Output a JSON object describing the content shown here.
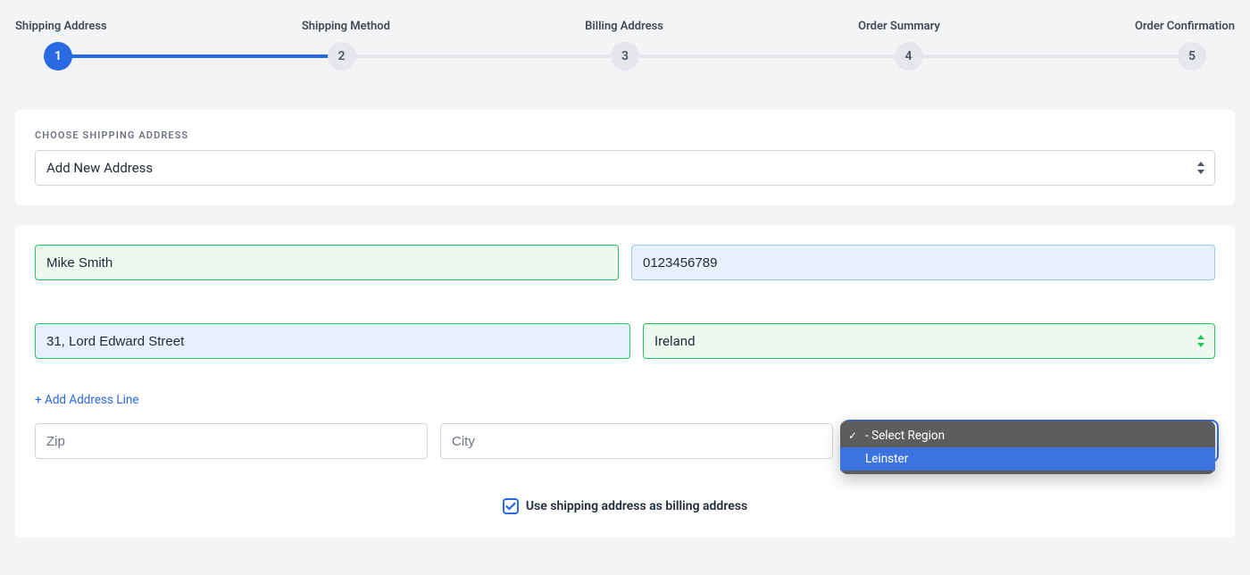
{
  "stepper": {
    "steps": [
      {
        "label": "Shipping Address",
        "num": "1",
        "active": true
      },
      {
        "label": "Shipping Method",
        "num": "2",
        "active": false
      },
      {
        "label": "Billing Address",
        "num": "3",
        "active": false
      },
      {
        "label": "Order Summary",
        "num": "4",
        "active": false
      },
      {
        "label": "Order Confirmation",
        "num": "5",
        "active": false
      }
    ]
  },
  "choose": {
    "label": "CHOOSE SHIPPING ADDRESS",
    "value": "Add New Address"
  },
  "form": {
    "name": "Mike Smith",
    "phone": "0123456789",
    "street": "31, Lord Edward Street",
    "country": "Ireland",
    "add_line": "+ Add Address Line",
    "zip_placeholder": "Zip",
    "city_placeholder": "City",
    "region_options": {
      "placeholder": "- Select Region",
      "opt1": "Leinster"
    }
  },
  "billing_checkbox": {
    "label": "Use shipping address as billing address",
    "checked": true
  }
}
